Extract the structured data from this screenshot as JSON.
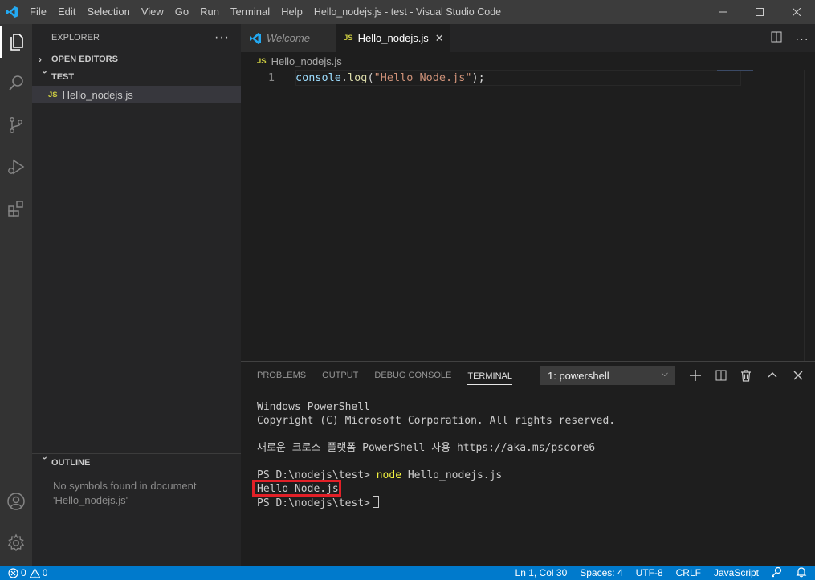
{
  "window": {
    "title": "Hello_nodejs.js - test - Visual Studio Code",
    "menu": [
      "File",
      "Edit",
      "Selection",
      "View",
      "Go",
      "Run",
      "Terminal",
      "Help"
    ]
  },
  "sidebar": {
    "header": "EXPLORER",
    "open_editors": "OPEN EDITORS",
    "folder": "TEST",
    "files": [
      {
        "badge": "JS",
        "name": "Hello_nodejs.js"
      }
    ],
    "outline_title": "OUTLINE",
    "outline_msg_line1": "No symbols found in document",
    "outline_msg_line2": "'Hello_nodejs.js'"
  },
  "editor": {
    "tabs": [
      {
        "label": "Welcome",
        "icon": "vscode-logo-icon",
        "active": false
      },
      {
        "label": "Hello_nodejs.js",
        "icon": "JS",
        "active": true
      }
    ],
    "breadcrumb": {
      "badge": "JS",
      "file": "Hello_nodejs.js"
    },
    "lines": [
      {
        "num": "1",
        "tokens": {
          "obj": "console",
          "dot": ".",
          "fn": "log",
          "open": "(",
          "str": "\"Hello Node.js\"",
          "close": ");"
        }
      }
    ]
  },
  "panel": {
    "tabs": [
      "PROBLEMS",
      "OUTPUT",
      "DEBUG CONSOLE",
      "TERMINAL"
    ],
    "active_tab": "TERMINAL",
    "terminal_select": "1: powershell",
    "terminal": {
      "line1": "Windows PowerShell",
      "line2": "Copyright (C) Microsoft Corporation. All rights reserved.",
      "line3": "",
      "line4": "새로운 크로스 플랫폼 PowerShell 사용 https://aka.ms/pscore6",
      "line5": "",
      "prompt": "PS D:\\nodejs\\test> ",
      "command": "node",
      "command_arg": " Hello_nodejs.js",
      "output": "Hello Node.js",
      "prompt2": "PS D:\\nodejs\\test>"
    }
  },
  "statusbar": {
    "errors": "0",
    "warnings": "0",
    "position": "Ln 1, Col 30",
    "spaces": "Spaces: 4",
    "encoding": "UTF-8",
    "eol": "CRLF",
    "language": "JavaScript"
  },
  "colors": {
    "accent": "#007acc",
    "highlight_box": "#e22027",
    "js_badge": "#cbcb41"
  }
}
